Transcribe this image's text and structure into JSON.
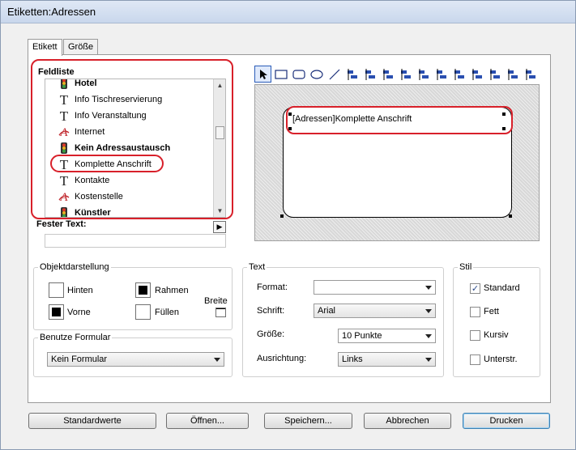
{
  "window": {
    "title": "Etiketten:Adressen"
  },
  "tabs": [
    {
      "label": "Etikett",
      "active": true
    },
    {
      "label": "Größe",
      "active": false
    }
  ],
  "feldliste": {
    "title": "Feldliste",
    "items": [
      {
        "label": "Hotel",
        "icon": "traffic-light-icon",
        "bold": true
      },
      {
        "label": "Info Tischreservierung",
        "icon": "text-t-icon",
        "bold": false
      },
      {
        "label": "Info Veranstaltung",
        "icon": "text-t-icon",
        "bold": false
      },
      {
        "label": "Internet",
        "icon": "link-a-icon",
        "bold": false
      },
      {
        "label": "Kein Adressaustausch",
        "icon": "traffic-light-icon",
        "bold": true
      },
      {
        "label": "Komplette Anschrift",
        "icon": "text-t-icon",
        "bold": false,
        "highlighted": true
      },
      {
        "label": "Kontakte",
        "icon": "text-t-icon",
        "bold": false
      },
      {
        "label": "Kostenstelle",
        "icon": "link-a-icon",
        "bold": false
      },
      {
        "label": "Künstler",
        "icon": "traffic-light-icon",
        "bold": true
      }
    ]
  },
  "fester_text": {
    "label": "Fester Text:",
    "value": ""
  },
  "toolbar": {
    "tools": [
      "pointer-icon",
      "rectangle-icon",
      "rounded-rectangle-icon",
      "ellipse-icon",
      "line-icon",
      "align-left-icon",
      "align-hcenter-icon",
      "align-right-icon",
      "align-top-icon",
      "align-vcenter-icon",
      "align-bottom-icon",
      "distribute-h-icon",
      "distribute-v-icon",
      "bring-front-icon",
      "send-back-icon",
      "group-icon"
    ]
  },
  "canvas": {
    "field_text": "[Adressen]Komplette Anschrift"
  },
  "objektdarstellung": {
    "title": "Objektdarstellung",
    "hinten": "Hinten",
    "vorne": "Vorne",
    "rahmen": "Rahmen",
    "fuellen": "Füllen",
    "breite": "Breite"
  },
  "text_group": {
    "title": "Text",
    "format_label": "Format:",
    "format_value": "",
    "schrift_label": "Schrift:",
    "schrift_value": "Arial",
    "groesse_label": "Größe:",
    "groesse_value": "10 Punkte",
    "ausrichtung_label": "Ausrichtung:",
    "ausrichtung_value": "Links"
  },
  "stil": {
    "title": "Stil",
    "options": [
      {
        "label": "Standard",
        "checked": true
      },
      {
        "label": "Fett",
        "checked": false
      },
      {
        "label": "Kursiv",
        "checked": false
      },
      {
        "label": "Unterstr.",
        "checked": false
      }
    ]
  },
  "formular": {
    "title": "Benutze Formular",
    "value": "Kein Formular"
  },
  "buttons": {
    "standardwerte": "Standardwerte",
    "oeffnen": "Öffnen...",
    "speichern": "Speichern...",
    "abbrechen": "Abbrechen",
    "drucken": "Drucken"
  },
  "colors": {
    "highlight_red": "#d8202a",
    "accent_blue": "#2b5cb8"
  }
}
